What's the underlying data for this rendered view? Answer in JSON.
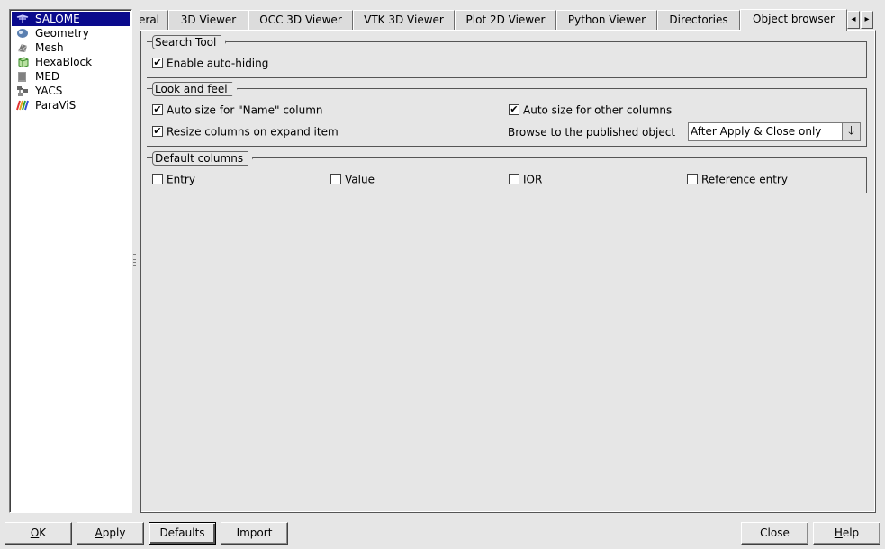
{
  "modules": [
    {
      "label": "SALOME",
      "icon": "salome-icon",
      "selected": true
    },
    {
      "label": "Geometry",
      "icon": "geometry-icon"
    },
    {
      "label": "Mesh",
      "icon": "mesh-icon"
    },
    {
      "label": "HexaBlock",
      "icon": "hexablock-icon"
    },
    {
      "label": "MED",
      "icon": "med-icon"
    },
    {
      "label": "YACS",
      "icon": "yacs-icon"
    },
    {
      "label": "ParaViS",
      "icon": "paravis-icon"
    }
  ],
  "tabs": [
    "eral",
    "3D Viewer",
    "OCC 3D Viewer",
    "VTK 3D Viewer",
    "Plot 2D Viewer",
    "Python Viewer",
    "Directories",
    "Object browser"
  ],
  "active_tab": "Object browser",
  "tab_scroll": {
    "left": "◂",
    "right": "▸"
  },
  "search_tool": {
    "title": "Search Tool",
    "enable_auto_hiding": {
      "label": "Enable auto-hiding",
      "checked": true
    }
  },
  "look_and_feel": {
    "title": "Look and feel",
    "auto_size_name": {
      "label": "Auto size for \"Name\" column",
      "checked": true
    },
    "auto_size_other": {
      "label": "Auto size for other columns",
      "checked": true
    },
    "resize_on_expand": {
      "label": "Resize columns on expand item",
      "checked": true
    },
    "browse_label": "Browse to the published object",
    "browse_value": "After Apply & Close only"
  },
  "default_columns": {
    "title": "Default columns",
    "entry": {
      "label": "Entry",
      "checked": false
    },
    "value": {
      "label": "Value",
      "checked": false
    },
    "ior": {
      "label": "IOR",
      "checked": false
    },
    "reference_entry": {
      "label": "Reference entry",
      "checked": false
    }
  },
  "buttons": {
    "ok": {
      "pre": "",
      "ul": "O",
      "post": "K"
    },
    "apply": {
      "pre": "",
      "ul": "A",
      "post": "pply"
    },
    "defaults": "Defaults",
    "import": "Import",
    "close": {
      "pre": "Close",
      "ul": "",
      "post": ""
    },
    "help": {
      "pre": "",
      "ul": "H",
      "post": "elp"
    }
  },
  "check_mark": "✔"
}
